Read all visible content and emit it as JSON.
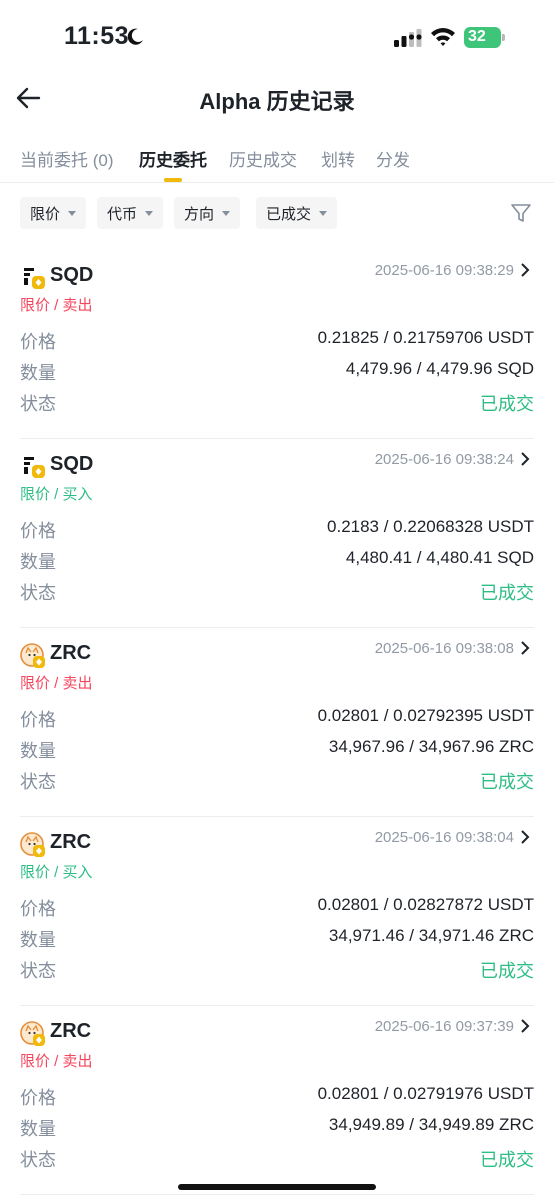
{
  "status_bar": {
    "time": "11:53",
    "battery_level": "32",
    "battery_color": "#3fc57a"
  },
  "header": {
    "title": "Alpha 历史记录"
  },
  "tabs": [
    {
      "label": "当前委托 (0)",
      "active": false
    },
    {
      "label": "历史委托",
      "active": true
    },
    {
      "label": "历史成交",
      "active": false
    },
    {
      "label": "划转",
      "active": false
    },
    {
      "label": "分发",
      "active": false
    }
  ],
  "filters": [
    {
      "label": "限价"
    },
    {
      "label": "代币"
    },
    {
      "label": "方向"
    },
    {
      "label": "已成交"
    }
  ],
  "labels": {
    "price": "价格",
    "amount": "数量",
    "status": "状态"
  },
  "orders": [
    {
      "symbol": "SQD",
      "time": "2025-06-16 09:38:29",
      "type": "限价 / 卖出",
      "side": "sell",
      "price": "0.21825 / 0.21759706 USDT",
      "amount": "4,479.96 / 4,479.96 SQD",
      "status": "已成交"
    },
    {
      "symbol": "SQD",
      "time": "2025-06-16 09:38:24",
      "type": "限价 / 买入",
      "side": "buy",
      "price": "0.2183 / 0.22068328 USDT",
      "amount": "4,480.41 / 4,480.41 SQD",
      "status": "已成交"
    },
    {
      "symbol": "ZRC",
      "time": "2025-06-16 09:38:08",
      "type": "限价 / 卖出",
      "side": "sell",
      "price": "0.02801 / 0.02792395 USDT",
      "amount": "34,967.96 / 34,967.96 ZRC",
      "status": "已成交"
    },
    {
      "symbol": "ZRC",
      "time": "2025-06-16 09:38:04",
      "type": "限价 / 买入",
      "side": "buy",
      "price": "0.02801 / 0.02827872 USDT",
      "amount": "34,971.46 / 34,971.46 ZRC",
      "status": "已成交"
    },
    {
      "symbol": "ZRC",
      "time": "2025-06-16 09:37:39",
      "type": "限价 / 卖出",
      "side": "sell",
      "price": "0.02801 / 0.02791976 USDT",
      "amount": "34,949.89 / 34,949.89 ZRC",
      "status": "已成交"
    }
  ],
  "colors": {
    "accent": "#f0b90b",
    "sell": "#f6465d",
    "buy": "#2ebd85"
  }
}
